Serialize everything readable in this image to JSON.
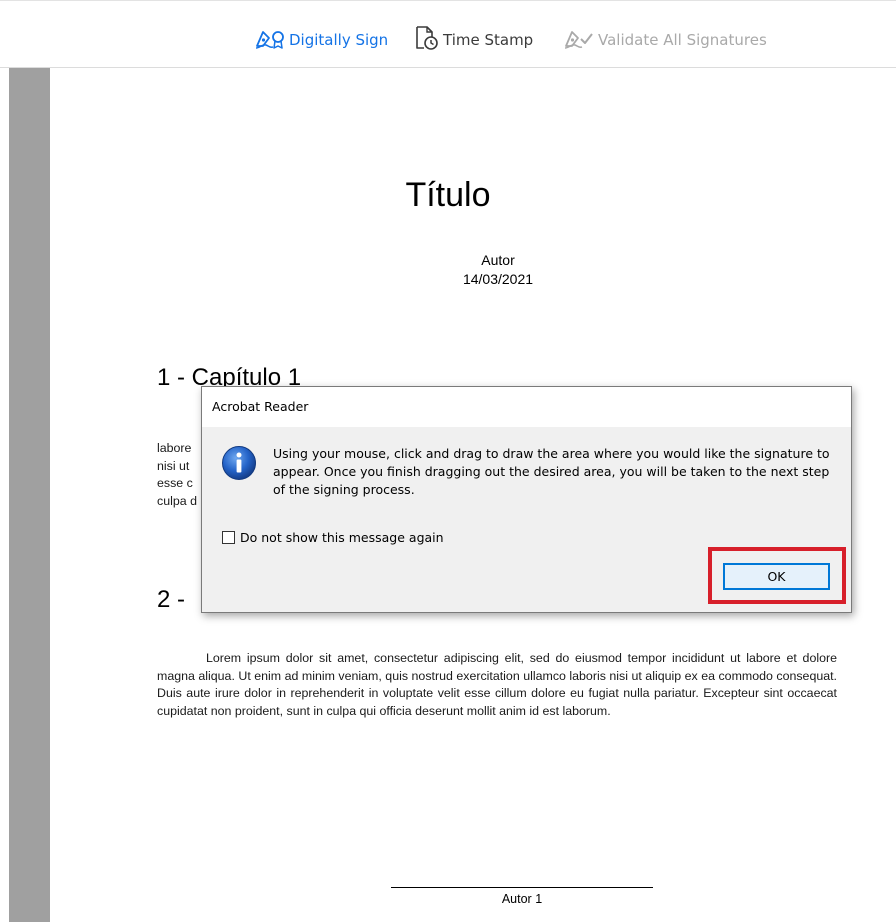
{
  "toolbar": {
    "digitally_sign": {
      "label": "Digitally Sign",
      "icon": "pen-sign-icon"
    },
    "time_stamp": {
      "label": "Time Stamp",
      "icon": "document-clock-icon"
    },
    "validate": {
      "label": "Validate All Signatures",
      "icon": "pen-validate-icon"
    }
  },
  "document": {
    "title": "Título",
    "author": "Autor",
    "date": "14/03/2021",
    "chapter1_heading": "1 - Capítulo 1",
    "chapter1_visible_lines": "labore\nnisi ut\nesse c\nculpa d",
    "chapter2_heading_prefix": "2 - ",
    "paragraph": "Lorem ipsum dolor sit amet, consectetur adipiscing elit, sed do eiusmod tempor incididunt ut labore et dolore magna aliqua. Ut enim ad minim veniam, quis nostrud exercitation ullamco laboris nisi ut aliquip ex ea commodo consequat. Duis aute irure dolor in reprehenderit in voluptate velit esse cillum dolore eu fugiat nulla pariatur. Excepteur sint occaecat cupidatat non proident, sunt in culpa qui officia deserunt mollit anim id est laborum.",
    "signature_label": "Autor 1"
  },
  "dialog": {
    "title": "Acrobat Reader",
    "message": "Using your mouse, click and drag to draw the area where you would like the signature to appear. Once you finish dragging out the desired area, you will be taken to the next step of the signing process.",
    "checkbox_label": "Do not show this message again",
    "checkbox_checked": false,
    "ok_label": "OK"
  },
  "colors": {
    "accent_blue": "#1473e6",
    "highlight_red": "#d71f2a",
    "disabled_gray": "#a9a9a9"
  }
}
